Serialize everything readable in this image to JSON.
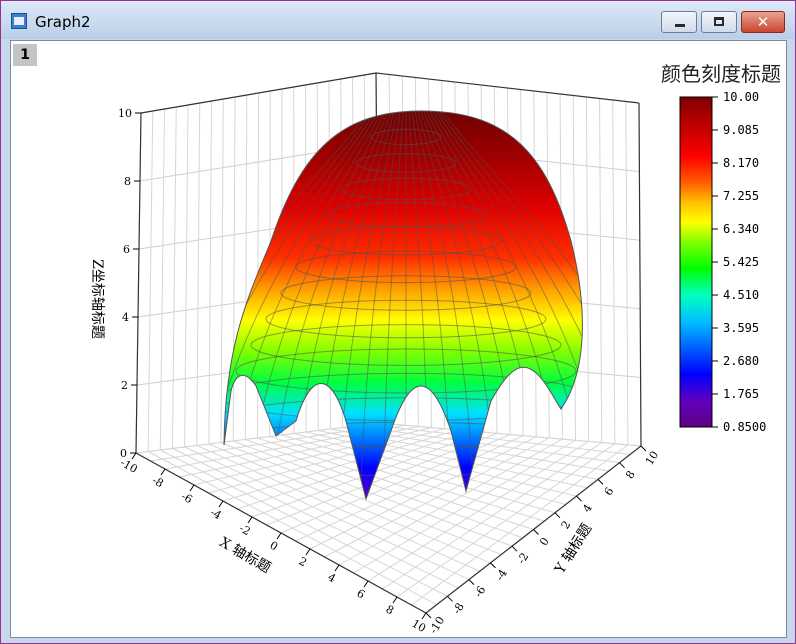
{
  "window": {
    "title": "Graph2",
    "layer_label": "1",
    "close_symbol": "✕"
  },
  "colors": {
    "window_frame": "#9a2f8f",
    "titlebar": "#c9dbf0",
    "close_button": "#c8472f"
  },
  "chart_data": {
    "type": "surface",
    "title": "",
    "axes": {
      "x": {
        "label": "X 轴标题",
        "ticks": [
          -10,
          -8,
          -6,
          -4,
          -2,
          0,
          2,
          4,
          6,
          8,
          10
        ],
        "range": [
          -10,
          10
        ]
      },
      "y": {
        "label": "Y 轴标题",
        "ticks": [
          -10,
          -8,
          -6,
          -4,
          -2,
          0,
          2,
          4,
          6,
          8,
          10
        ],
        "range": [
          -10,
          10
        ]
      },
      "z": {
        "label": "Z坐标轴标题",
        "ticks": [
          0,
          2,
          4,
          6,
          8,
          10
        ],
        "range": [
          0,
          10
        ]
      }
    },
    "surface": {
      "peak_z": 10.0,
      "min_z": 0.85,
      "shape": "dome",
      "mesh": true
    },
    "colorbar": {
      "title": "颜色刻度标题",
      "labels": [
        "10.00",
        "9.085",
        "8.170",
        "7.255",
        "6.340",
        "5.425",
        "4.510",
        "3.595",
        "2.680",
        "1.765",
        "0.8500"
      ],
      "colormap": [
        "#800000",
        "#c00000",
        "#ff0000",
        "#ff6000",
        "#ffc000",
        "#ffff00",
        "#80ff00",
        "#00ff00",
        "#00ffc0",
        "#00c0ff",
        "#0060ff",
        "#0000ff",
        "#6000c0",
        "#600080"
      ]
    },
    "grid": true,
    "legend_position": "right"
  }
}
